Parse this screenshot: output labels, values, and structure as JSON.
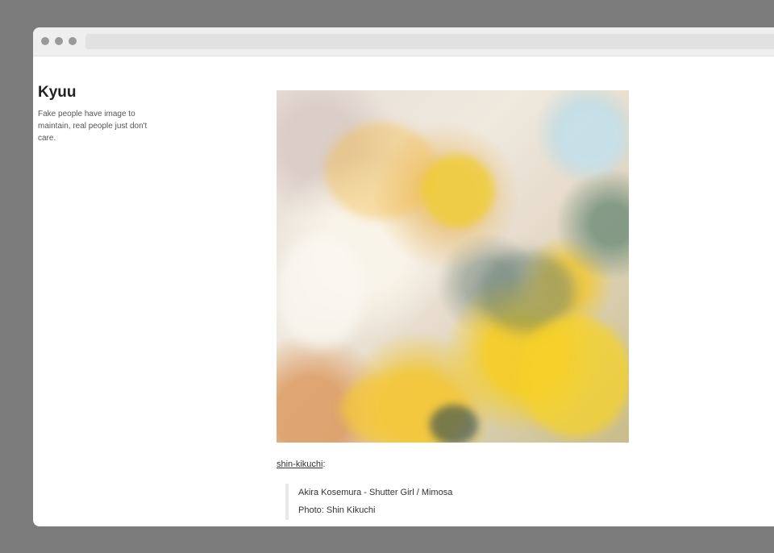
{
  "blog": {
    "title": "Kyuu",
    "description": "Fake people have image to maintain, real people just don't care."
  },
  "post": {
    "photo_icon": "mimosa-photo",
    "source_link": "shin-kikuchi",
    "source_suffix": ":",
    "quote_lines": [
      "Akira Kosemura - Shutter Girl / Mimosa",
      "Photo: Shin Kikuchi"
    ]
  },
  "colors": {
    "background": "#7b7b7b",
    "window": "#ffffff",
    "titlebar": "#efefef",
    "accent_yellow": "#f2cf2e"
  }
}
